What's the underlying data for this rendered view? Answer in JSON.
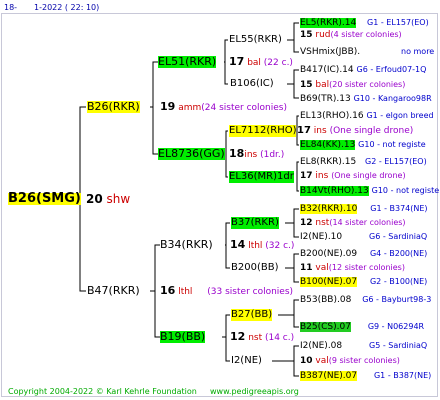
{
  "header": {
    "prefix": "18-",
    "date": "1-2022 ( 22: 10)"
  },
  "footer": {
    "copyright": "Copyright 2004-2022 © Karl Kehrle Foundation",
    "site": "www.pedigreeapis.org"
  },
  "root": {
    "name": "B26(SMG)",
    "num": "20",
    "code": "shw"
  },
  "gen1": [
    {
      "name": "B26(RKR)",
      "num": "19",
      "code": "amm",
      "colonies": "(24 sister colonies)"
    },
    {
      "name": "B47(RKR)",
      "num": "16",
      "code": "lthl",
      "colonies": "(33 sister colonies)"
    }
  ],
  "gen2": [
    {
      "name": "EL51(RKR)",
      "num": "17",
      "code": "bal",
      "colonies": "(22 c.)"
    },
    {
      "name": "EL8736(GG)",
      "num": "18",
      "code": "ins",
      "colonies": "(1dr.)"
    },
    {
      "name": "B34(RKR)",
      "num": "14",
      "code": "lthl",
      "colonies": "(32 c.)"
    },
    {
      "name": "B19(BB)",
      "num": "12",
      "code": "nst",
      "colonies": "(14 c.)"
    }
  ],
  "gen3": [
    {
      "name": "EL55(RKR)"
    },
    {
      "name": "B106(IC)"
    },
    {
      "name": "EL7112(RHO)",
      "num": "17",
      "code": "ins",
      "colonies": "(One single drone)"
    },
    {
      "name": "EL36(MR)1dr"
    },
    {
      "name": "B37(RKR)"
    },
    {
      "name": "B200(BB)"
    },
    {
      "name": "B27(BB)",
      "num": "10",
      "code": "lthl",
      "colonies": "(32 sister colonies)"
    },
    {
      "name": "I2(NE)"
    }
  ],
  "gen4": [
    {
      "name": "EL5(RKR).14",
      "info": "G1 - EL157(EO)"
    },
    {
      "num": "15",
      "code": "rud",
      "colonies": "(4 sister colonies)"
    },
    {
      "name": "VSHmix(JBB).",
      "info": "no more"
    },
    {
      "name": "B417(IC).14",
      "info": "G6 - Erfoud07-1Q"
    },
    {
      "num": "15",
      "code": "bal",
      "colonies": "(20 sister colonies)"
    },
    {
      "name": "B69(TR).13",
      "info": "G10 - Kangaroo98R"
    },
    {
      "name": "EL13(RHO).16",
      "info": "G1 - elgon breed"
    },
    {
      "name": "EL84(KK).13",
      "info": "G10 - not registe"
    },
    {
      "name": "EL8(RKR).15",
      "info": "G2 - EL157(EO)"
    },
    {
      "num": "17",
      "code": "ins",
      "colonies": "(One single drone)"
    },
    {
      "name": "B14Vt(RHO).13",
      "info": "G10 - not registe"
    },
    {
      "name": "B32(RKR).10",
      "info": "G1 - B374(NE)"
    },
    {
      "num": "12",
      "code": "nst",
      "colonies": "(14 sister colonies)"
    },
    {
      "name": "I2(NE).10",
      "info": "G6 - SardiniaQ"
    },
    {
      "name": "B200(NE).09",
      "info": "G4 - B200(NE)"
    },
    {
      "num": "11",
      "code": "val",
      "colonies": "(12 sister colonies)"
    },
    {
      "name": "B100(NE).07",
      "info": "G2 - B100(NE)"
    },
    {
      "name": "B53(BB).08",
      "info": "G6 - Bayburt98-3"
    },
    {
      "name": "B25(CS).07",
      "info": "G9 - N06294R"
    },
    {
      "name": "I2(NE).08",
      "info": "G5 - SardiniaQ"
    },
    {
      "num": "10",
      "code": "val",
      "colonies": "(9 sister colonies)"
    },
    {
      "name": "B387(NE).07",
      "info": "G1 - B387(NE)"
    }
  ],
  "colors": {
    "green": "#00ee00",
    "yellow": "#ffff00",
    "line": "#000000"
  }
}
